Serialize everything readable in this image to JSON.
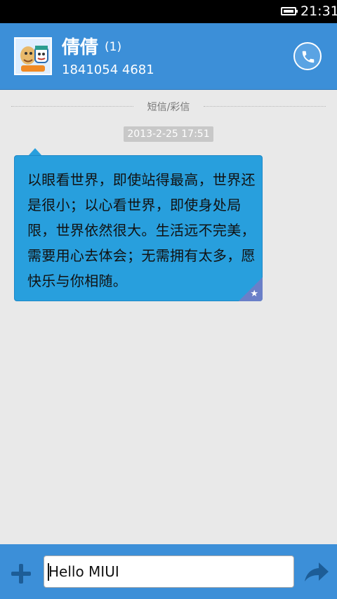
{
  "status_bar": {
    "time": "21:31"
  },
  "header": {
    "contact_name": "倩倩",
    "unread_count": "(1)",
    "phone_number": "1841054 4681"
  },
  "thread": {
    "message_type_label": "短信/彩信",
    "timestamp": "2013-2-25 17:51",
    "message_text": "以眼看世界，即使站得最高，世界还是很小；以心看世界，即使身处局限，世界依然很大。生活远不完美，需要用心去体会；无需拥有太多，愿快乐与你相随。"
  },
  "composer": {
    "input_value": "Hello MIUI"
  },
  "colors": {
    "accent": "#3c8fd8",
    "bubble": "#289fdd",
    "background": "#e9e9e9"
  }
}
